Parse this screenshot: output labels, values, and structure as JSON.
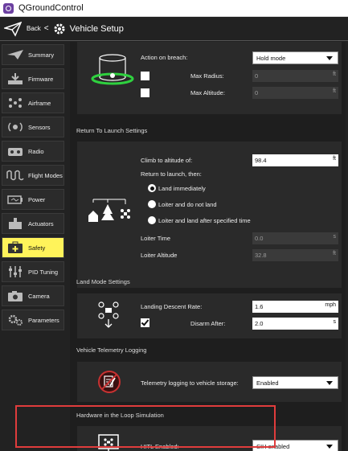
{
  "window": {
    "title": "QGroundControl"
  },
  "toolbar": {
    "back_label": "Back",
    "separator": "<",
    "page_title": "Vehicle Setup"
  },
  "sidebar": {
    "items": [
      {
        "label": "Summary",
        "icon": "plane-icon"
      },
      {
        "label": "Firmware",
        "icon": "download-icon"
      },
      {
        "label": "Airframe",
        "icon": "airframe-icon"
      },
      {
        "label": "Sensors",
        "icon": "sensors-icon"
      },
      {
        "label": "Radio",
        "icon": "radio-icon"
      },
      {
        "label": "Flight Modes",
        "icon": "wave-icon"
      },
      {
        "label": "Power",
        "icon": "battery-icon"
      },
      {
        "label": "Actuators",
        "icon": "actuator-icon"
      },
      {
        "label": "Safety",
        "icon": "medkit-icon"
      },
      {
        "label": "PID Tuning",
        "icon": "sliders-icon"
      },
      {
        "label": "Camera",
        "icon": "camera-icon"
      },
      {
        "label": "Parameters",
        "icon": "gears-icon"
      }
    ],
    "active": "Safety"
  },
  "geofence": {
    "action_label": "Action on breach:",
    "action_value": "Hold mode",
    "max_radius_label": "Max Radius:",
    "max_radius_value": "0",
    "max_radius_unit": "ft",
    "max_alt_label": "Max Altitude:",
    "max_alt_value": "0",
    "max_alt_unit": "ft"
  },
  "rtl": {
    "title": "Return To Launch Settings",
    "climb_label": "Climb to altitude of:",
    "climb_value": "98.4",
    "climb_unit": "ft",
    "then_label": "Return to launch, then:",
    "opt_land": "Land immediately",
    "opt_loiter": "Loiter and do not land",
    "opt_loiter_land": "Loiter and land after specified time",
    "loiter_time_label": "Loiter Time",
    "loiter_time_value": "0.0",
    "loiter_time_unit": "s",
    "loiter_alt_label": "Loiter Altitude",
    "loiter_alt_value": "32.8",
    "loiter_alt_unit": "ft"
  },
  "land": {
    "title": "Land Mode Settings",
    "descent_label": "Landing Descent Rate:",
    "descent_value": "1.6",
    "descent_unit": "mph",
    "disarm_label": "Disarm After:",
    "disarm_value": "2.0",
    "disarm_unit": "s"
  },
  "telemetry": {
    "title": "Vehicle Telemetry Logging",
    "label": "Telemetry logging to vehicle storage:",
    "value": "Enabled"
  },
  "hitl": {
    "title": "Hardware in the Loop Simulation",
    "label": "HITL Enabled:",
    "value": "SIH enabled"
  },
  "colors": {
    "active_tab": "#fff35a",
    "highlight": "#e03c3c",
    "geofence_green": "#2fd13f"
  }
}
